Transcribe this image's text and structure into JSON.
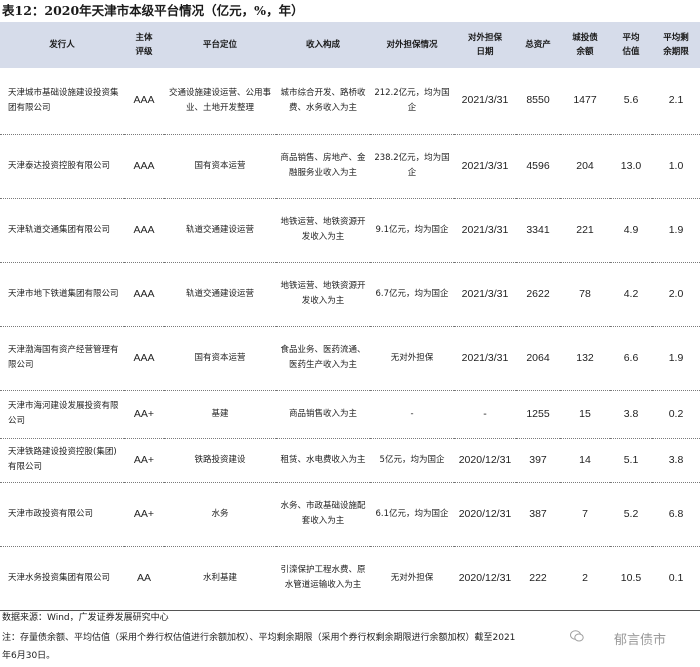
{
  "title": "表12：2020年天津市本级平台情况（亿元，%，年）",
  "headers": [
    "发行人",
    "主体\n评级",
    "平台定位",
    "收入构成",
    "对外担保情况",
    "对外担保\n日期",
    "总资产",
    "城投债\n余额",
    "平均\n估值",
    "平均剩\n余期限"
  ],
  "rows": [
    [
      "天津城市基础设施建设投资集团有限公司",
      "AAA",
      "交通设施建设运营、公用事业、土地开发整理",
      "城市综合开发、路桥收费、水务收入为主",
      "212.2亿元，均为国企",
      "2021/3/31",
      "8550",
      "1477",
      "5.6",
      "2.1"
    ],
    [
      "天津泰达投资控股有限公司",
      "AAA",
      "国有资本运营",
      "商品销售、房地产、金融服务业收入为主",
      "238.2亿元，均为国企",
      "2021/3/31",
      "4596",
      "204",
      "13.0",
      "1.0"
    ],
    [
      "天津轨道交通集团有限公司",
      "AAA",
      "轨道交通建设运营",
      "地铁运营、地铁资源开发收入为主",
      "9.1亿元，均为国企",
      "2021/3/31",
      "3341",
      "221",
      "4.9",
      "1.9"
    ],
    [
      "天津市地下铁道集团有限公司",
      "AAA",
      "轨道交通建设运营",
      "地铁运营、地铁资源开发收入为主",
      "6.7亿元，均为国企",
      "2021/3/31",
      "2622",
      "78",
      "4.2",
      "2.0"
    ],
    [
      "天津渤海国有资产经营管理有限公司",
      "AAA",
      "国有资本运营",
      "食品业务、医药流通、医药生产收入为主",
      "无对外担保",
      "2021/3/31",
      "2064",
      "132",
      "6.6",
      "1.9"
    ],
    [
      "天津市海河建设发展投资有限公司",
      "AA+",
      "基建",
      "商品销售收入为主",
      "-",
      "-",
      "1255",
      "15",
      "3.8",
      "0.2"
    ],
    [
      "天津铁路建设投资控股(集团)有限公司",
      "AA+",
      "铁路投资建设",
      "租赁、水电费收入为主",
      "5亿元，均为国企",
      "2020/12/31",
      "397",
      "14",
      "5.1",
      "3.8"
    ],
    [
      "天津市政投资有限公司",
      "AA+",
      "水务",
      "水务、市政基础设施配套收入为主",
      "6.1亿元，均为国企",
      "2020/12/31",
      "387",
      "7",
      "5.2",
      "6.8"
    ],
    [
      "天津水务投资集团有限公司",
      "AA",
      "水利基建",
      "引滦保护工程水费、原水管道运输收入为主",
      "无对外担保",
      "2020/12/31",
      "222",
      "2",
      "10.5",
      "0.1"
    ]
  ],
  "footer": {
    "source": "数据来源：Wind，广发证券发展研究中心",
    "note_line1": "注：存量债余额、平均估值（采用个券行权估值进行余额加权）、平均剩余期限（采用个券行权剩余期限进行余额加权）截至2021",
    "note_line2": "年6月30日。"
  },
  "watermark": "郁言债市"
}
